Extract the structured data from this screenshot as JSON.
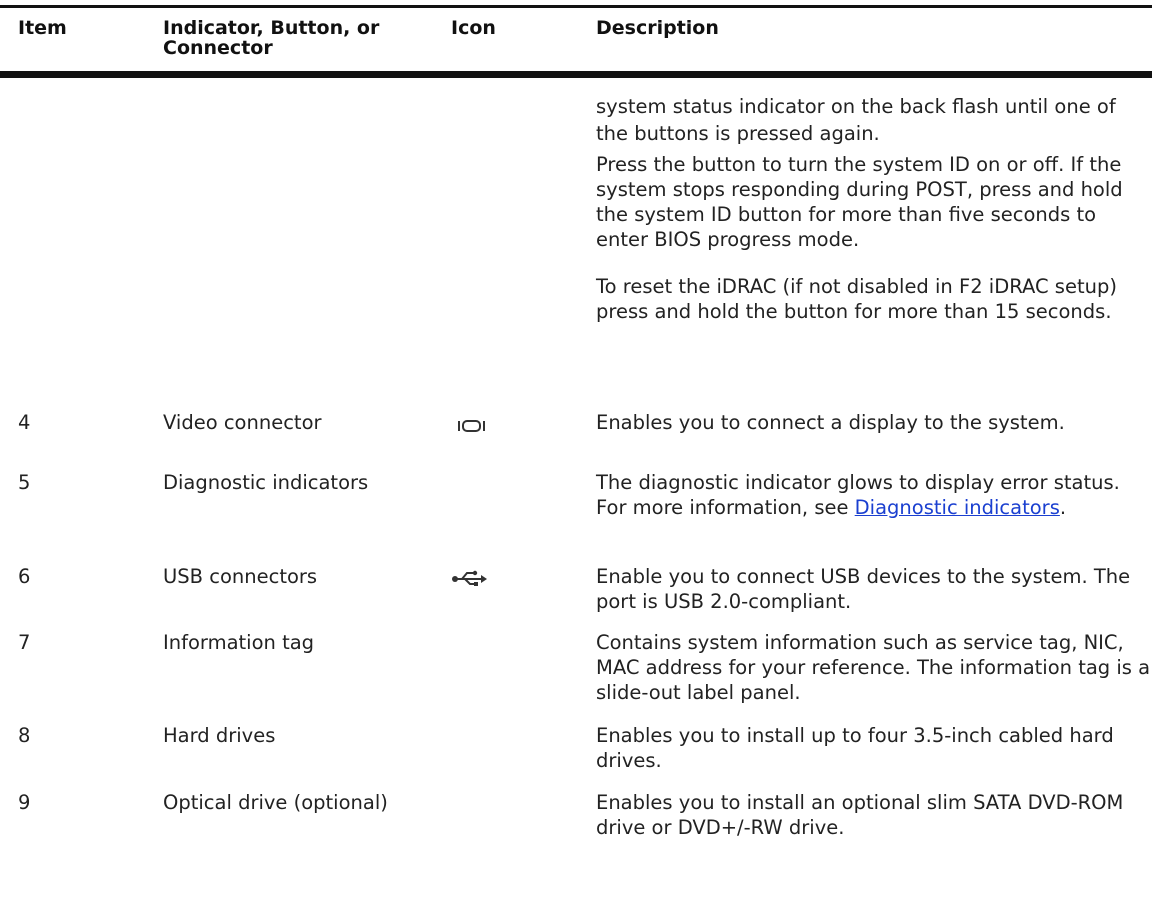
{
  "headers": {
    "item": "Item",
    "indicator": "Indicator, Button, or Connector",
    "icon": "Icon",
    "description": "Description"
  },
  "continuation": {
    "p1": "system status indicator on the back flash until one of the buttons is pressed again.",
    "p2": "Press the button to turn the system ID on or off. If the system stops responding during POST, press and hold the system ID button for more than five seconds to enter BIOS progress mode.",
    "p3": "To reset the iDRAC (if not disabled in F2 iDRAC setup) press and hold the button for more than 15 seconds."
  },
  "rows": [
    {
      "item": "4",
      "name": "Video connector",
      "icon": "video-connector-icon",
      "description": "Enables you to connect a display to the system."
    },
    {
      "item": "5",
      "name": "Diagnostic indicators",
      "description_pre": "The diagnostic indicator glows to display error status. For more information, see ",
      "link": "Diagnostic indicators",
      "description_post": "."
    },
    {
      "item": "6",
      "name": "USB connectors",
      "icon": "usb-icon",
      "description": "Enable you to connect USB devices to the system. The port is USB 2.0-compliant."
    },
    {
      "item": "7",
      "name": "Information tag",
      "description": "Contains system information such as service tag, NIC, MAC address for your reference. The information tag is a slide-out label panel."
    },
    {
      "item": "8",
      "name": "Hard drives",
      "description": "Enables you to install up to four 3.5-inch cabled hard drives."
    },
    {
      "item": "9",
      "name": "Optical drive (optional)",
      "description": "Enables you to install an optional slim SATA DVD-ROM drive or DVD+/-RW drive."
    }
  ],
  "colors": {
    "link": "#1a3fd0",
    "rule": "#111111"
  }
}
